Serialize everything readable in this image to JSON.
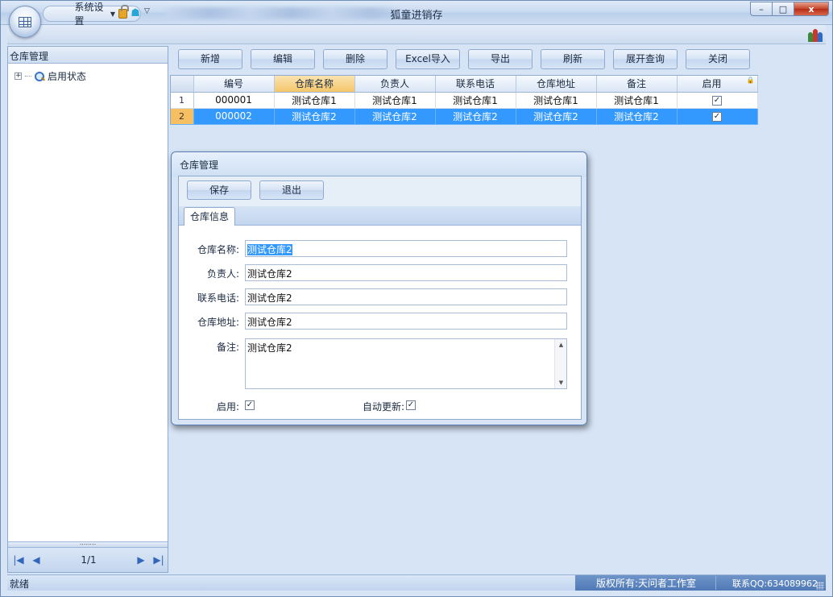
{
  "window": {
    "title": "狐童进销存",
    "qat_menu_label": "系统设置",
    "controls": {
      "minimize": "–",
      "maximize": "□",
      "close": "x"
    }
  },
  "left_panel": {
    "title": "仓库管理",
    "tree": [
      {
        "label": "启用状态",
        "expander": "+"
      }
    ],
    "pager": {
      "first": "|◀",
      "prev": "◀",
      "info": "1/1",
      "next": "▶",
      "last": "▶|"
    }
  },
  "toolbar": {
    "buttons": [
      "新增",
      "编辑",
      "删除",
      "Excel导入",
      "导出",
      "刷新",
      "展开查询",
      "关闭"
    ]
  },
  "grid": {
    "columns": [
      "编号",
      "仓库名称",
      "负责人",
      "联系电话",
      "仓库地址",
      "备注",
      "启用"
    ],
    "active_column": "仓库名称",
    "rows": [
      {
        "rownum": "1",
        "cells": [
          "000001",
          "测试仓库1",
          "测试仓库1",
          "测试仓库1",
          "测试仓库1",
          "测试仓库1"
        ],
        "enabled": "✓"
      },
      {
        "rownum": "2",
        "cells": [
          "000002",
          "测试仓库2",
          "测试仓库2",
          "测试仓库2",
          "测试仓库2",
          "测试仓库2"
        ],
        "enabled": "✓",
        "selected": true
      }
    ]
  },
  "dialog": {
    "title": "仓库管理",
    "buttons": {
      "save": "保存",
      "exit": "退出"
    },
    "tab": "仓库信息",
    "fields": {
      "name": {
        "label": "仓库名称:",
        "value": "测试仓库2"
      },
      "manager": {
        "label": "负责人:",
        "value": "测试仓库2"
      },
      "phone": {
        "label": "联系电话:",
        "value": "测试仓库2"
      },
      "address": {
        "label": "仓库地址:",
        "value": "测试仓库2"
      },
      "remark": {
        "label": "备注:",
        "value": "测试仓库2"
      }
    },
    "checkboxes": {
      "enabled": {
        "label": "启用:",
        "mark": "✓"
      },
      "auto_update": {
        "label": "自动更新:",
        "mark": "✓"
      }
    }
  },
  "statusbar": {
    "left": "就绪",
    "copyright": "版权所有:天问者工作室",
    "contact": "联系QQ:634089962"
  },
  "colors": {
    "selection": "#3399ff",
    "active_header": "#f4c66a",
    "status_accent": "#4f79b6"
  }
}
